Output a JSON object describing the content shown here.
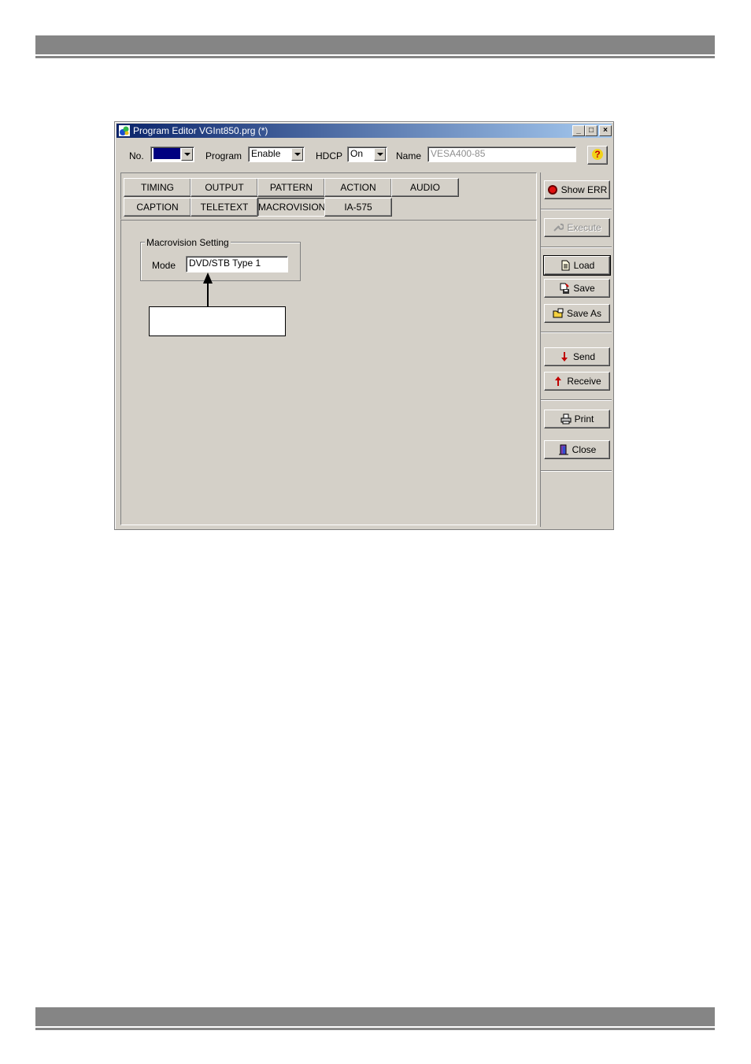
{
  "window": {
    "title": "Program Editor VGInt850.prg (*)",
    "minimize": "_",
    "maximize": "□",
    "close": "×"
  },
  "toolbar": {
    "no_label": "No.",
    "no_value": "",
    "program_label": "Program",
    "program_value": "Enable",
    "hdcp_label": "HDCP",
    "hdcp_value": "On",
    "name_label": "Name",
    "name_value": "VESA400-85",
    "help": "?"
  },
  "tabs": {
    "row1": [
      "TIMING",
      "OUTPUT",
      "PATTERN",
      "ACTION",
      "AUDIO"
    ],
    "row2": [
      "CAPTION",
      "TELETEXT",
      "MACROVISION",
      "IA-575"
    ],
    "active": "MACROVISION"
  },
  "macrovision": {
    "group_label": "Macrovision Setting",
    "mode_label": "Mode",
    "mode_value": "DVD/STB Type 1"
  },
  "side_buttons": {
    "show_err": "Show ERR",
    "execute": "Execute",
    "load": "Load",
    "save": "Save",
    "save_as": "Save As",
    "send": "Send",
    "receive": "Receive",
    "print": "Print",
    "close": "Close"
  },
  "colors": {
    "face": "#d4d0c8",
    "title_start": "#0a246a",
    "title_end": "#a6caf0",
    "band": "#858585",
    "selection": "#000080"
  }
}
